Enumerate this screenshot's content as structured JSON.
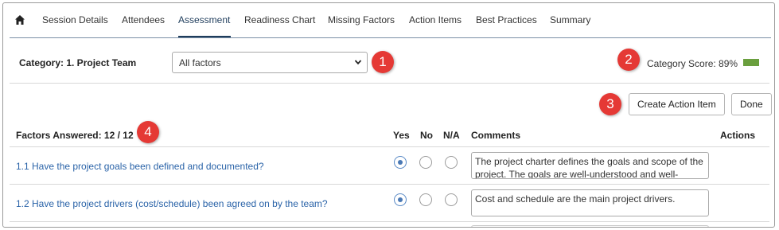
{
  "tabs": [
    {
      "label": "Session Details"
    },
    {
      "label": "Attendees"
    },
    {
      "label": "Assessment",
      "active": true
    },
    {
      "label": "Readiness Chart"
    },
    {
      "label": "Missing Factors"
    },
    {
      "label": "Action Items"
    },
    {
      "label": "Best Practices"
    },
    {
      "label": "Summary"
    }
  ],
  "category": {
    "label": "Category: 1. Project Team",
    "filter_value": "All factors",
    "score_text": "Category Score: 89%",
    "score_bar_color": "#6a9f3e"
  },
  "badges": [
    "1",
    "2",
    "3",
    "4"
  ],
  "buttons": {
    "create_action_item": "Create Action Item",
    "done": "Done"
  },
  "table": {
    "factors_answered": "Factors Answered: 12 / 12",
    "headers": {
      "yes": "Yes",
      "no": "No",
      "na": "N/A",
      "comments": "Comments",
      "actions": "Actions"
    },
    "rows": [
      {
        "factor": "1.1 Have the project goals been defined and documented?",
        "answer": "yes",
        "comment": "The project charter defines the goals and scope of the project. The goals are well-understood and well-"
      },
      {
        "factor": "1.2 Have the project drivers (cost/schedule) been agreed on by the team?",
        "answer": "yes",
        "comment": "Cost and schedule are the main project drivers."
      }
    ]
  },
  "colors": {
    "accent": "#1f3d5c",
    "link": "#2a63a8",
    "badge": "#e53935"
  },
  "icons": {
    "home": "home-icon",
    "select_arrow": "chevron-down-icon"
  }
}
